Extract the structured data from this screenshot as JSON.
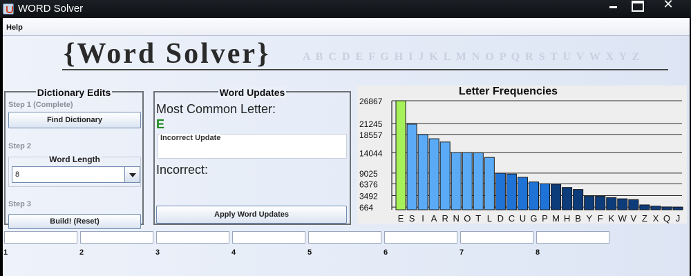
{
  "window": {
    "title": "WORD Solver"
  },
  "menu": {
    "help": "Help"
  },
  "logo": {
    "text": "{Word Solver}",
    "alphabet": "A B C D E F G H I J K L M N O P Q R S T U V W X Y Z"
  },
  "dictionary_panel": {
    "title": "Dictionary Edits",
    "step1": "Step 1 (Complete)",
    "find_button": "Find Dictionary",
    "step2": "Step 2",
    "word_length_label": "Word Length",
    "word_length_value": "8",
    "step3": "Step 3",
    "build_button": "Build!  (Reset)"
  },
  "updates_panel": {
    "title": "Word Updates",
    "most_common_label": "Most Common Letter:",
    "most_common_value": "E",
    "incorrect_update_label": "Incorrect Update",
    "incorrect_label": "Incorrect:",
    "apply_button": "Apply Word Updates"
  },
  "slots": [
    "1",
    "2",
    "3",
    "4",
    "5",
    "6",
    "7",
    "8"
  ],
  "chart_data": {
    "type": "bar",
    "title": "Letter Frequencies",
    "categories": [
      "E",
      "S",
      "I",
      "A",
      "R",
      "N",
      "O",
      "T",
      "L",
      "D",
      "C",
      "U",
      "G",
      "P",
      "M",
      "H",
      "B",
      "Y",
      "F",
      "K",
      "W",
      "V",
      "Z",
      "X",
      "Q",
      "J"
    ],
    "values": [
      26867,
      21100,
      18500,
      17500,
      16700,
      14100,
      14100,
      14050,
      12900,
      9000,
      8800,
      8000,
      6850,
      6400,
      6300,
      5500,
      5000,
      3400,
      3350,
      3000,
      2700,
      2500,
      1200,
      900,
      700,
      650
    ],
    "highlight": "E",
    "yticks": [
      664,
      3492,
      6376,
      9025,
      14044,
      18557,
      21245,
      26867
    ],
    "ylim": [
      0,
      26867
    ],
    "colors": {
      "highlight": "#a6f05a",
      "light": "#5aaaf5",
      "mid": "#1f73d6",
      "dark": "#0d3c7a",
      "grid": "#2a2a2a"
    }
  }
}
